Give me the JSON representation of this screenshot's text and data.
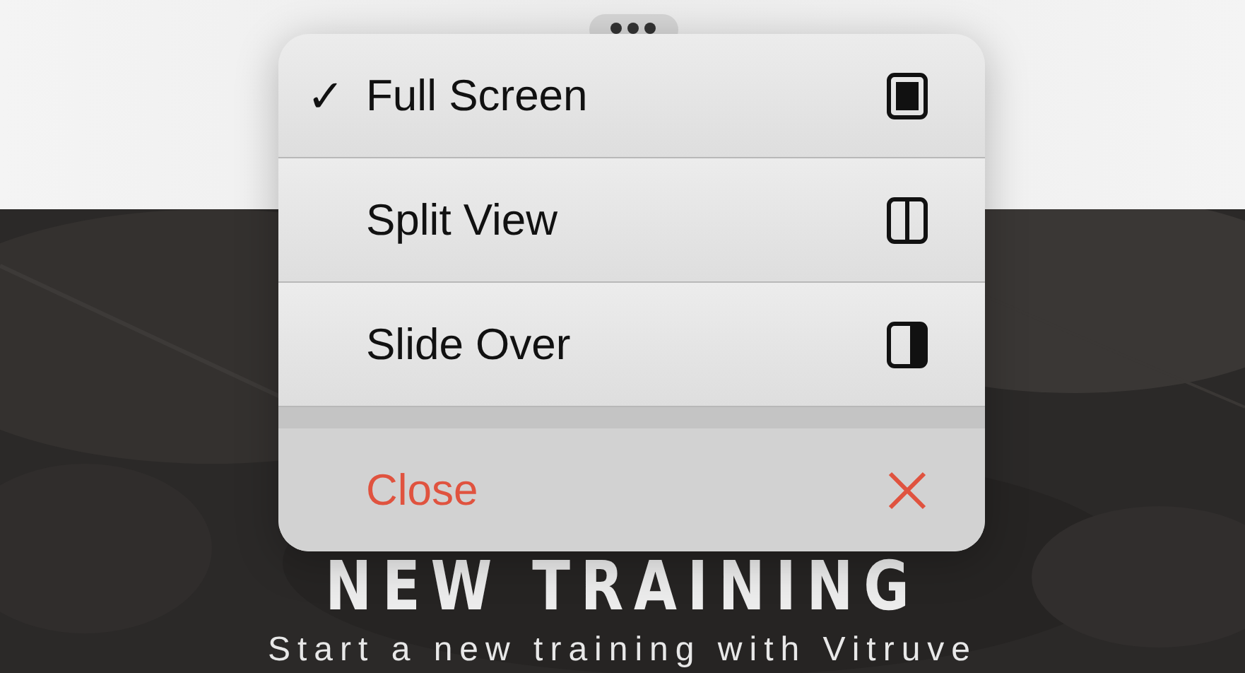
{
  "menu": {
    "items": [
      {
        "label": "Full Screen",
        "kind": "option",
        "checked": true
      },
      {
        "label": "Split View",
        "kind": "option",
        "checked": false
      },
      {
        "label": "Slide Over",
        "kind": "option",
        "checked": false
      },
      {
        "label": "Close",
        "kind": "destructive"
      }
    ]
  },
  "check_mark": "✓",
  "hero": {
    "title": "NEW TRAINING",
    "subtitle": "Start a new training with Vitruve"
  }
}
